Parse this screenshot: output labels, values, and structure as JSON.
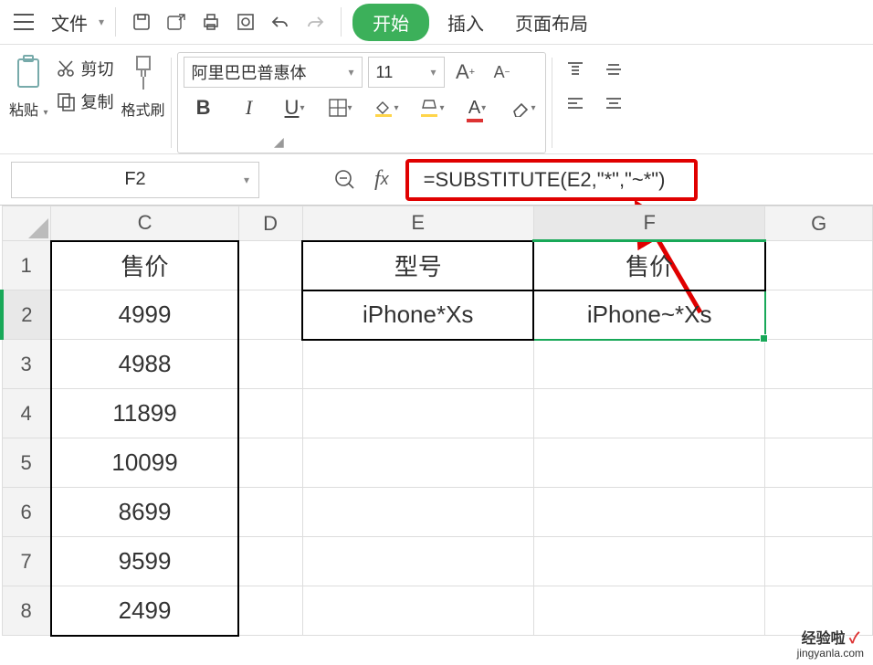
{
  "menubar": {
    "file": "文件",
    "tabs": {
      "start": "开始",
      "insert": "插入",
      "layout": "页面布局"
    }
  },
  "ribbon": {
    "paste": "粘贴",
    "cut": "剪切",
    "copy": "复制",
    "fmt": "格式刷",
    "font_name": "阿里巴巴普惠体",
    "font_size": "11"
  },
  "fxbar": {
    "namebox": "F2",
    "formula": "=SUBSTITUTE(E2,\"*\",\"~*\")"
  },
  "sheet": {
    "cols": {
      "C": "C",
      "D": "D",
      "E": "E",
      "F": "F",
      "G": "G"
    },
    "rows": [
      "1",
      "2",
      "3",
      "4",
      "5",
      "6",
      "7",
      "8"
    ],
    "c_header": "售价",
    "c": [
      "4999",
      "4988",
      "11899",
      "10099",
      "8699",
      "9599",
      "2499"
    ],
    "e_header": "型号",
    "f_header": "售价",
    "e2": "iPhone*Xs",
    "f2": "iPhone~*Xs"
  },
  "watermark": {
    "line1": "经验啦",
    "line2": "jingyanla.com"
  }
}
